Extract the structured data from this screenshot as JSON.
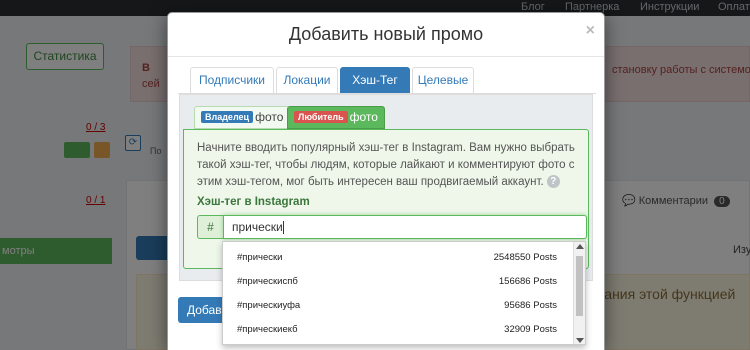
{
  "background": {
    "topnav": [
      "Блог",
      "Партнерка",
      "Инструкции",
      "Оплата"
    ],
    "stats_button": "Статистика",
    "alert_left": "В",
    "alert_left2": "сей",
    "alert_right": "становку работы с системой",
    "count1": "0 / 3",
    "count2": "0 / 1",
    "po_text": "По",
    "green_bar": "мотры",
    "comments": "Комментарии",
    "comments_count": "0",
    "izu": "Изу",
    "yellow_text": "вания этой функцией"
  },
  "modal": {
    "title": "Добавить новый промо",
    "close": "×",
    "tabs": [
      "Подписчики",
      "Локации",
      "Хэш-Тег",
      "Целевые"
    ],
    "active_tab": "Хэш-Тег",
    "subtabs": [
      {
        "badge": "Владелец",
        "text": "фото"
      },
      {
        "badge": "Любитель",
        "text": "фото"
      }
    ],
    "description": "Начните вводить популярный хэш-тег в Instagram. Вам нужно выбрать такой хэш-тег, чтобы людям, которые лайкают и комментируют фото с этим хэш-тегом, мог быть интересен ваш продвигаемый аккаунт.",
    "help_icon": "?",
    "field_label": "Хэш-тег в Instagram",
    "hash_symbol": "#",
    "input_value": "прически",
    "submit_button": "Добавить"
  },
  "dropdown": {
    "items": [
      {
        "name": "#прически",
        "count": "2548550 Posts"
      },
      {
        "name": "#прическиспб",
        "count": "156686 Posts"
      },
      {
        "name": "#прическиуфа",
        "count": "95686 Posts"
      },
      {
        "name": "#прическиекб",
        "count": "32909 Posts"
      }
    ]
  }
}
